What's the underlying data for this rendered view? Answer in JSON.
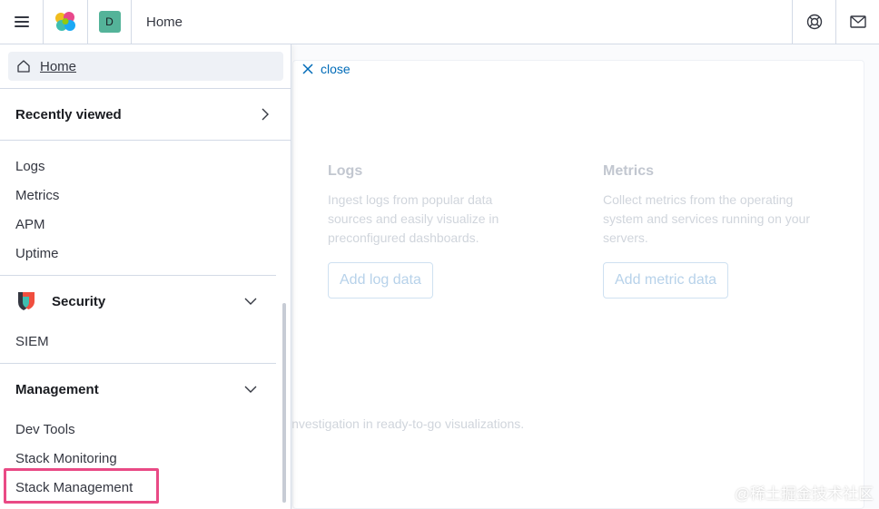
{
  "header": {
    "breadcrumb": "Home",
    "space_initial": "D",
    "icons": {
      "menu": "hamburger-icon",
      "logo": "elastic-logo",
      "help": "help-lifebuoy-icon",
      "mail": "mail-icon"
    }
  },
  "background": {
    "close_label": "close",
    "logs": {
      "title": "Logs",
      "description_lines": [
        "Ingest logs from popular data",
        "sources and easily visualize in",
        "preconfigured dashboards."
      ],
      "button": "Add log data"
    },
    "metrics": {
      "title": "Metrics",
      "description_lines": [
        "Collect metrics from the operating",
        "system and services running on your",
        "servers."
      ],
      "button": "Add metric data"
    },
    "partial_text": "investigation in ready-to-go visualizations."
  },
  "nav": {
    "home": "Home",
    "recently_viewed": "Recently viewed",
    "observability_links": [
      "Logs",
      "Metrics",
      "APM",
      "Uptime"
    ],
    "security": {
      "title": "Security",
      "links": [
        "SIEM"
      ]
    },
    "management": {
      "title": "Management",
      "links": [
        "Dev Tools",
        "Stack Monitoring",
        "Stack Management"
      ]
    }
  },
  "colors": {
    "accent": "#006bb8",
    "highlight": "#e94a85",
    "space_badge": "#54b399"
  },
  "watermark": "@稀土掘金技术社区"
}
